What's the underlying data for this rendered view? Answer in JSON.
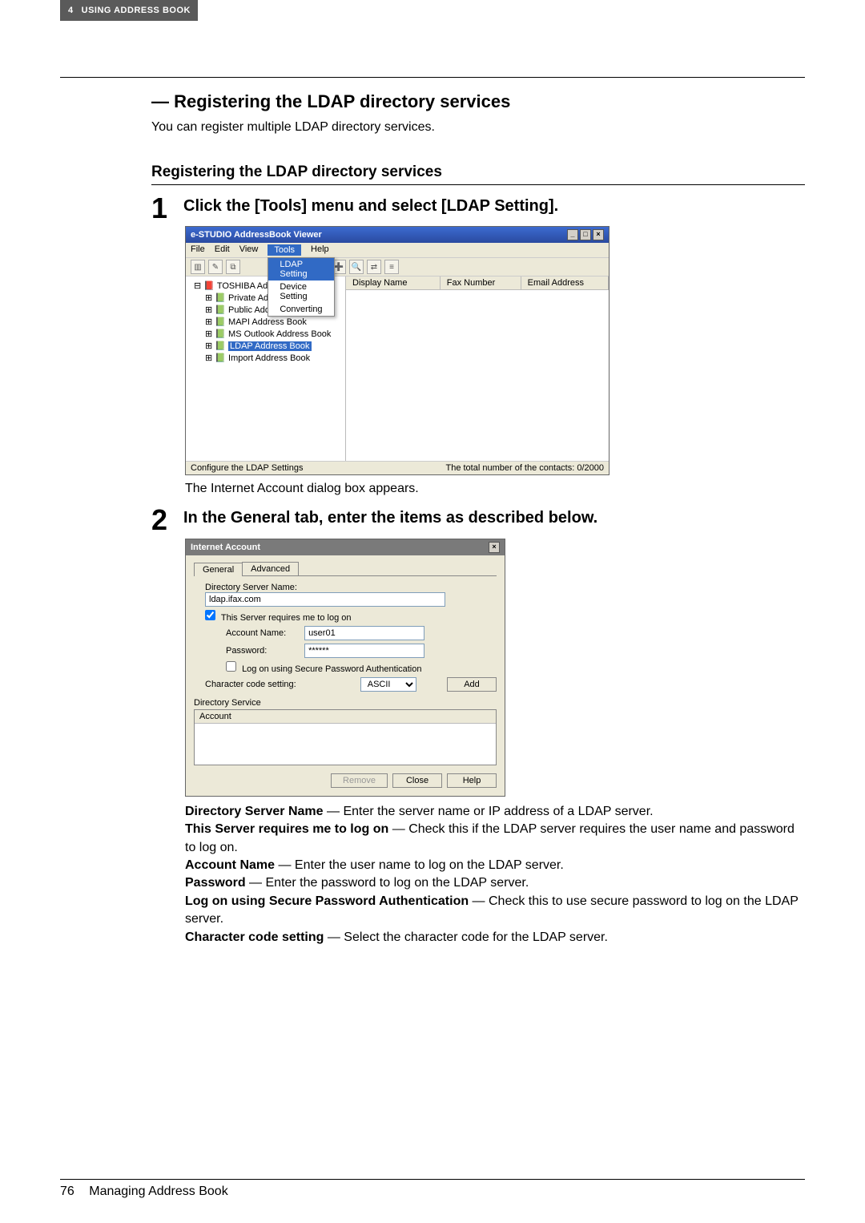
{
  "header": {
    "page_label": "4",
    "section": "USING ADDRESS BOOK"
  },
  "h1": "— Registering the LDAP directory services",
  "intro": "You can register multiple LDAP directory services.",
  "h2": "Registering the LDAP directory services",
  "step1": {
    "num": "1",
    "title": "Click the [Tools] menu and select [LDAP Setting].",
    "window_title": "e-STUDIO AddressBook Viewer",
    "menus": [
      "File",
      "Edit",
      "View",
      "Tools",
      "Help"
    ],
    "tools_items": [
      "LDAP Setting",
      "Device Setting",
      "Converting"
    ],
    "tree_root": "TOSHIBA AddressBook",
    "tree_children": [
      "Private Address Book",
      "Public Address Book",
      "MAPI Address Book",
      "MS Outlook Address Book",
      "LDAP Address Book",
      "Import Address Book"
    ],
    "tree_selected_index": 4,
    "list_cols": [
      "Display Name",
      "Fax Number",
      "Email Address"
    ],
    "status_left": "Configure the LDAP Settings",
    "status_right": "The total number of the contacts: 0/2000",
    "caption": "The Internet Account dialog box appears."
  },
  "step2": {
    "num": "2",
    "title": "In the General tab, enter the items as described below.",
    "dialog_title": "Internet Account",
    "tabs": [
      "General",
      "Advanced"
    ],
    "active_tab": 0,
    "dir_srv_label": "Directory Server Name:",
    "dir_srv_value": "ldap.ifax.com",
    "require_logon_label": "This Server requires me to log on",
    "require_logon_checked": true,
    "account_label": "Account Name:",
    "account_value": "user01",
    "password_label": "Password:",
    "password_value": "******",
    "spa_label": "Log on using Secure Password Authentication",
    "spa_checked": false,
    "charcode_label": "Character code setting:",
    "charcode_value": "ASCII",
    "add_btn": "Add",
    "dir_service_label": "Directory Service",
    "dsvc_col": "Account",
    "remove_btn": "Remove",
    "close_btn": "Close",
    "help_btn": "Help"
  },
  "desc": {
    "dsn_label": "Directory Server Name",
    "dsn_text": " — Enter the server name or IP address of a LDAP server.",
    "req_label": "This Server requires me to log on",
    "req_text": " — Check this if the LDAP server requires the user name and password to log on.",
    "acc_label": "Account Name",
    "acc_text": " — Enter the user name to log on the LDAP server.",
    "pwd_label": "Password",
    "pwd_text": " — Enter the password to log on the LDAP server.",
    "spa_label": "Log on using Secure Password Authentication",
    "spa_text": " — Check this to use secure password to log on the LDAP server.",
    "cc_label": "Character code setting",
    "cc_text": " — Select the character code for the LDAP server."
  },
  "footer": {
    "page_num": "76",
    "title": "Managing Address Book"
  }
}
